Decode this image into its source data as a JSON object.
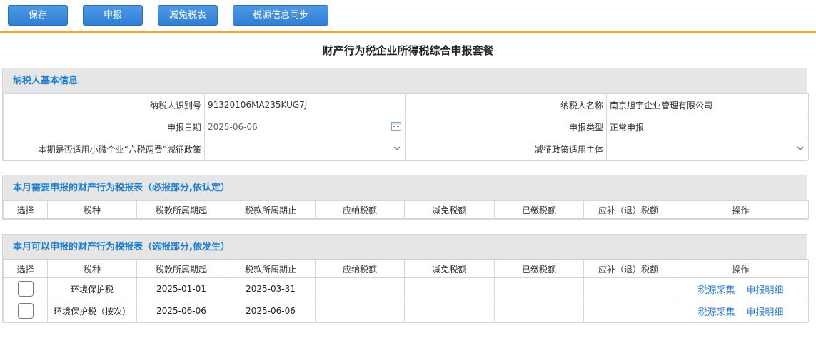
{
  "toolbar": {
    "save": "保存",
    "declare": "申报",
    "exemption": "减免税表",
    "sync": "税源信息同步"
  },
  "page": {
    "title": "财产行为税企业所得税综合申报套餐"
  },
  "basic_info": {
    "heading": "纳税人基本信息",
    "tax_id_label": "纳税人识别号",
    "tax_id": "91320106MA235KUG7J",
    "name_label": "纳税人名称",
    "name": "南京旭宇企业管理有限公司",
    "date_label": "申报日期",
    "date": "2025-06-06",
    "type_label": "申报类型",
    "type": "正常申报",
    "policy_label": "本期是否适用小微企业“六税两费”减征政策",
    "policy_value": "",
    "subject_label": "减征政策适用主体",
    "subject_value": ""
  },
  "columns": [
    "选择",
    "税种",
    "税款所属期起",
    "税款所属期止",
    "应纳税额",
    "减免税额",
    "已缴税额",
    "应补（退）税额",
    "操作"
  ],
  "required_section": {
    "heading": "本月需要申报的财产行为税报表（必报部分,依认定）"
  },
  "optional_section": {
    "heading": "本月可以申报的财产行为税报表（选报部分,依发生）",
    "rows": [
      {
        "tax": "环境保护税",
        "start": "2025-01-01",
        "end": "2025-03-31",
        "payable": "",
        "reduced": "",
        "paid": "",
        "due": "",
        "op1": "税源采集",
        "op2": "申报明细"
      },
      {
        "tax": "环境保护税（按次）",
        "start": "2025-06-06",
        "end": "2025-06-06",
        "payable": "",
        "reduced": "",
        "paid": "",
        "due": "",
        "op1": "税源采集",
        "op2": "申报明细"
      }
    ]
  }
}
